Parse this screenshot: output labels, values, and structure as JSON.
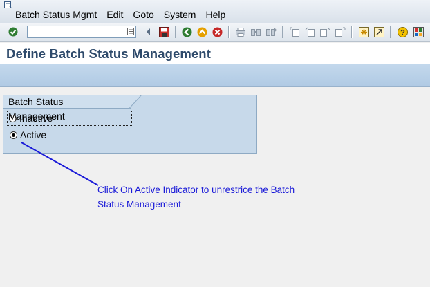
{
  "menubar": {
    "items": [
      {
        "label": "Batch Status Mgmt",
        "name": "menu-batch-status-mgmt"
      },
      {
        "label": "Edit",
        "name": "menu-edit"
      },
      {
        "label": "Goto",
        "name": "menu-goto"
      },
      {
        "label": "System",
        "name": "menu-system"
      },
      {
        "label": "Help",
        "name": "menu-help"
      }
    ]
  },
  "toolbar": {
    "command_field_value": "",
    "icons": [
      "enter-icon",
      "command-field",
      "command-history-icon",
      "back-arrow-icon",
      "save-icon",
      "back-icon",
      "exit-icon",
      "cancel-icon",
      "print-icon",
      "find-icon",
      "find-next-icon",
      "first-page-icon",
      "previous-page-icon",
      "next-page-icon",
      "last-page-icon",
      "create-session-icon",
      "shortcut-icon",
      "help-icon",
      "customize-layout-icon"
    ]
  },
  "page": {
    "title": "Define Batch Status Management"
  },
  "group": {
    "title": "Batch Status Management",
    "options": [
      {
        "label": "Inactive",
        "checked": false
      },
      {
        "label": "Active",
        "checked": true
      }
    ]
  },
  "annotation": {
    "line1": "Click On Active Indicator to unrestrice the Batch",
    "line2": "Status Management",
    "color": "#1a1ad8"
  }
}
